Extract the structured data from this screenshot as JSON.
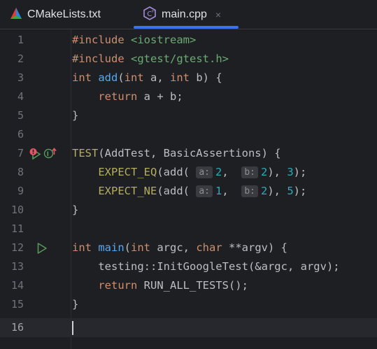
{
  "tabs": [
    {
      "label": "CMakeLists.txt",
      "icon": "cmake-icon",
      "active": false
    },
    {
      "label": "main.cpp",
      "icon": "cpp-file-icon",
      "active": true,
      "close": "×"
    }
  ],
  "colors": {
    "background": "#1e1f22",
    "keyword": "#cf8e6d",
    "string": "#6aab73",
    "function": "#56a8f5",
    "macro": "#b3ae60",
    "number": "#2aacb8",
    "line_number": "#6f737a",
    "accent": "#3574f0"
  },
  "editor": {
    "line_numbers": [
      "1",
      "2",
      "3",
      "4",
      "5",
      "6",
      "7",
      "8",
      "9",
      "10",
      "11",
      "12",
      "13",
      "14",
      "15",
      "16"
    ],
    "current_line": 16,
    "lines": {
      "l1": {
        "a": "#include ",
        "b": "<iostream>"
      },
      "l2": {
        "a": "#include ",
        "b": "<gtest/gtest.h>"
      },
      "l3": {
        "kw1": "int",
        "sp1": " ",
        "fn": "add",
        "p1": "(",
        "kw2": "int",
        "p2": " a, ",
        "kw3": "int",
        "p3": " b) {"
      },
      "l4": {
        "indent": "    ",
        "kw": "return",
        "rest": " a + b;"
      },
      "l5": {
        "t": "}"
      },
      "l7": {
        "mac": "TEST",
        "rest": "(AddTest, BasicAssertions) {"
      },
      "l8": {
        "indent": "    ",
        "mac": "EXPECT_EQ",
        "p1": "(add( ",
        "h1": "a:",
        "n1": "2",
        "p2": ",  ",
        "h2": "b:",
        "n2": "2",
        "p3": "), ",
        "n3": "3",
        "p4": ");"
      },
      "l9": {
        "indent": "    ",
        "mac": "EXPECT_NE",
        "p1": "(add( ",
        "h1": "a:",
        "n1": "1",
        "p2": ",  ",
        "h2": "b:",
        "n2": "2",
        "p3": "), ",
        "n3": "5",
        "p4": ");"
      },
      "l10": {
        "t": "}"
      },
      "l12": {
        "kw1": "int",
        "sp1": " ",
        "fn": "main",
        "p1": "(",
        "kw2": "int",
        "p2": " argc, ",
        "kw3": "char",
        "p3": " **argv) {"
      },
      "l13": {
        "indent": "    ",
        "ns": "testing",
        "rest": "::InitGoogleTest(&argc, argv);"
      },
      "l14": {
        "indent": "    ",
        "kw": "return",
        "rest": " RUN_ALL_TESTS();"
      },
      "l15": {
        "t": "}"
      }
    }
  }
}
